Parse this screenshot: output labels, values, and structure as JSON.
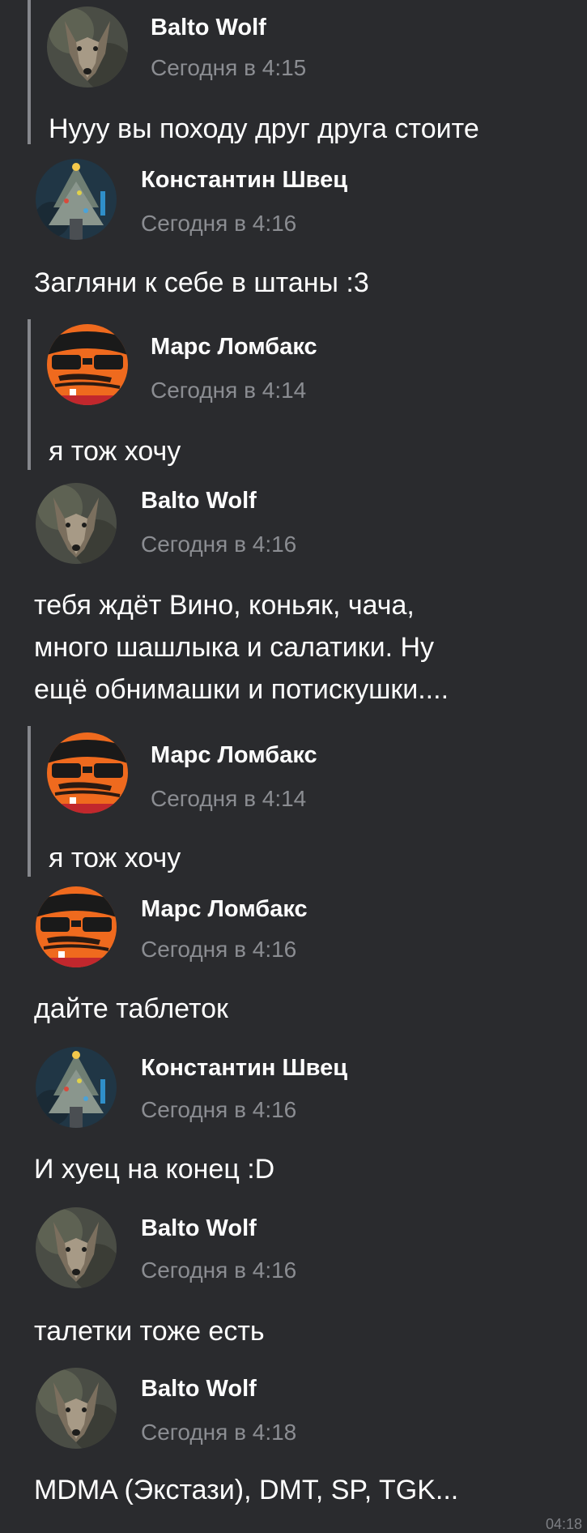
{
  "messages": [
    {
      "author": "Balto Wolf",
      "time": "Сегодня в 4:15",
      "text": "Нууу вы походу друг друга стоите",
      "quoted": true,
      "avatar": "wolf-avatar"
    },
    {
      "author": "Константин Швец",
      "time": "Сегодня в 4:16",
      "text": "Загляни к себе в штаны :3",
      "quoted": false,
      "avatar": "christmas-tree-avatar"
    },
    {
      "author": "Марс Ломбакс",
      "time": "Сегодня в 4:14",
      "text": "я тож хочу",
      "quoted": true,
      "avatar": "masked-lombax-avatar"
    },
    {
      "author": "Balto Wolf",
      "time": "Сегодня в 4:16",
      "text_lines": [
        "тебя ждёт Вино, коньяк, чача,",
        "много шашлыка и салатики. Ну",
        "ещё обнимашки и потискушки...."
      ],
      "quoted": false,
      "avatar": "wolf-avatar"
    },
    {
      "author": "Марс Ломбакс",
      "time": "Сегодня в 4:14",
      "text": "я тож хочу",
      "quoted": true,
      "avatar": "masked-lombax-avatar"
    },
    {
      "author": "Марс Ломбакс",
      "time": "Сегодня в 4:16",
      "text": "дайте таблеток",
      "quoted": false,
      "avatar": "masked-lombax-avatar"
    },
    {
      "author": "Константин Швец",
      "time": "Сегодня в 4:16",
      "text": "И хуец на конец :D",
      "quoted": false,
      "avatar": "christmas-tree-avatar"
    },
    {
      "author": "Balto Wolf",
      "time": "Сегодня в 4:16",
      "text": "талетки тоже есть",
      "quoted": false,
      "avatar": "wolf-avatar"
    },
    {
      "author": "Balto Wolf",
      "time": "Сегодня в 4:18",
      "text": "MDMA (Экстази), DMT, SP, TGK...",
      "quoted": false,
      "avatar": "wolf-avatar"
    }
  ],
  "corner_time": "04:18",
  "colors": {
    "background": "#2a2b2e",
    "text": "#ffffff",
    "meta": "#8b8d92",
    "quote_bar": "#85878c",
    "lombax_orange": "#ef6a1e"
  }
}
